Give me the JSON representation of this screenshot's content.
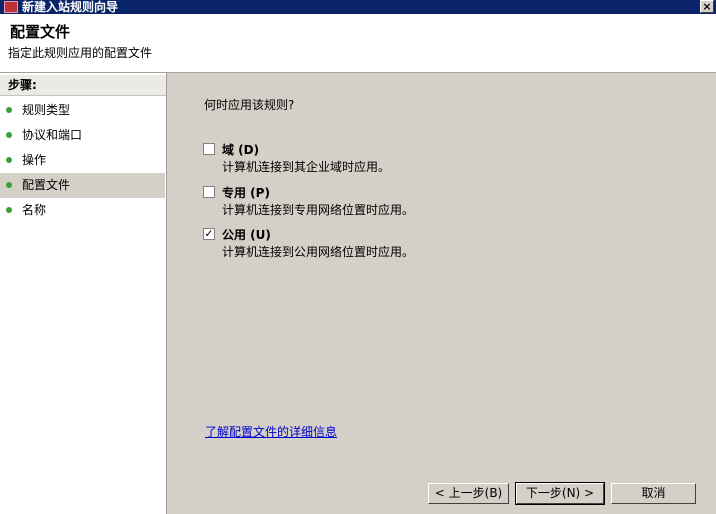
{
  "window": {
    "title": "新建入站规则向导",
    "close_glyph": "×"
  },
  "header": {
    "title": "配置文件",
    "subtitle": "指定此规则应用的配置文件"
  },
  "steps": {
    "header": "步骤:",
    "items": [
      {
        "label": "规则类型"
      },
      {
        "label": "协议和端口"
      },
      {
        "label": "操作"
      },
      {
        "label": "配置文件"
      },
      {
        "label": "名称"
      }
    ]
  },
  "main": {
    "prompt": "何时应用该规则?",
    "options": [
      {
        "label": "域 (D)",
        "desc": "计算机连接到其企业域时应用。",
        "checked": false,
        "check": ""
      },
      {
        "label": "专用 (P)",
        "desc": "计算机连接到专用网络位置时应用。",
        "checked": false,
        "check": ""
      },
      {
        "label": "公用 (U)",
        "desc": "计算机连接到公用网络位置时应用。",
        "checked": true,
        "check": "✓"
      }
    ],
    "link": "了解配置文件的详细信息"
  },
  "buttons": {
    "back": "< 上一步(B)",
    "next": "下一步(N) >",
    "cancel": "取消"
  }
}
